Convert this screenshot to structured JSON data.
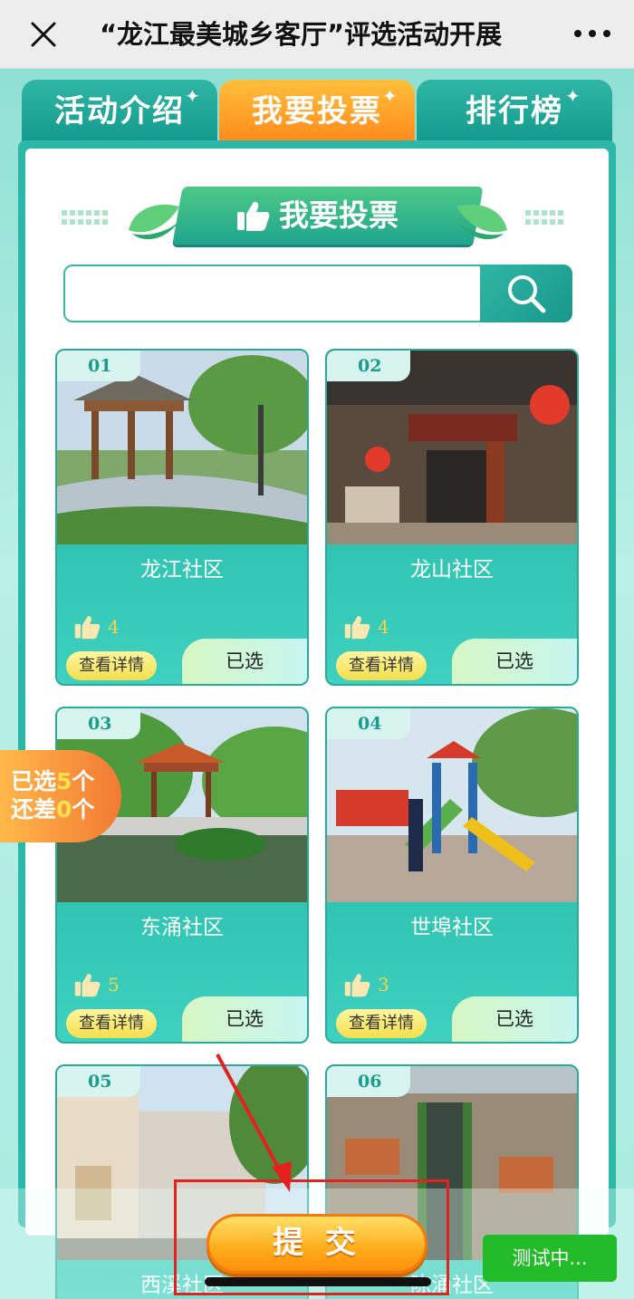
{
  "topbar": {
    "title": "“龙江最美城乡客厅”评选活动开展",
    "close_icon": "close-icon",
    "more_icon": "more-icon"
  },
  "tabs": [
    {
      "label": "活动介绍",
      "active": false
    },
    {
      "label": "我要投票",
      "active": true
    },
    {
      "label": "排行榜",
      "active": false
    }
  ],
  "banner": {
    "title": "我要投票",
    "icon": "thumbs-up-icon"
  },
  "search": {
    "value": "",
    "placeholder": "",
    "icon": "search-icon"
  },
  "cards": [
    {
      "num": "01",
      "name": "龙江社区",
      "likes": "4",
      "detail_label": "查看详情",
      "status_label": "已选"
    },
    {
      "num": "02",
      "name": "龙山社区",
      "likes": "4",
      "detail_label": "查看详情",
      "status_label": "已选"
    },
    {
      "num": "03",
      "name": "东涌社区",
      "likes": "5",
      "detail_label": "查看详情",
      "status_label": "已选"
    },
    {
      "num": "04",
      "name": "世埠社区",
      "likes": "3",
      "detail_label": "查看详情",
      "status_label": "已选"
    },
    {
      "num": "05",
      "name": "西溪社区"
    },
    {
      "num": "06",
      "name": "陈涌社区"
    }
  ],
  "side_badge": {
    "line1_prefix": "已选",
    "line1_count": "5",
    "line1_suffix": "个",
    "line2_prefix": "还差",
    "line2_count": "0",
    "line2_suffix": "个"
  },
  "submit_label": "提 交",
  "test_button_label": "测试中...",
  "colors": {
    "accent": "#2cb8a6",
    "active_tab": "#ff9d24",
    "like": "#f7d34a",
    "test_button": "#22bb2a",
    "highlight_box": "#e3221f"
  }
}
